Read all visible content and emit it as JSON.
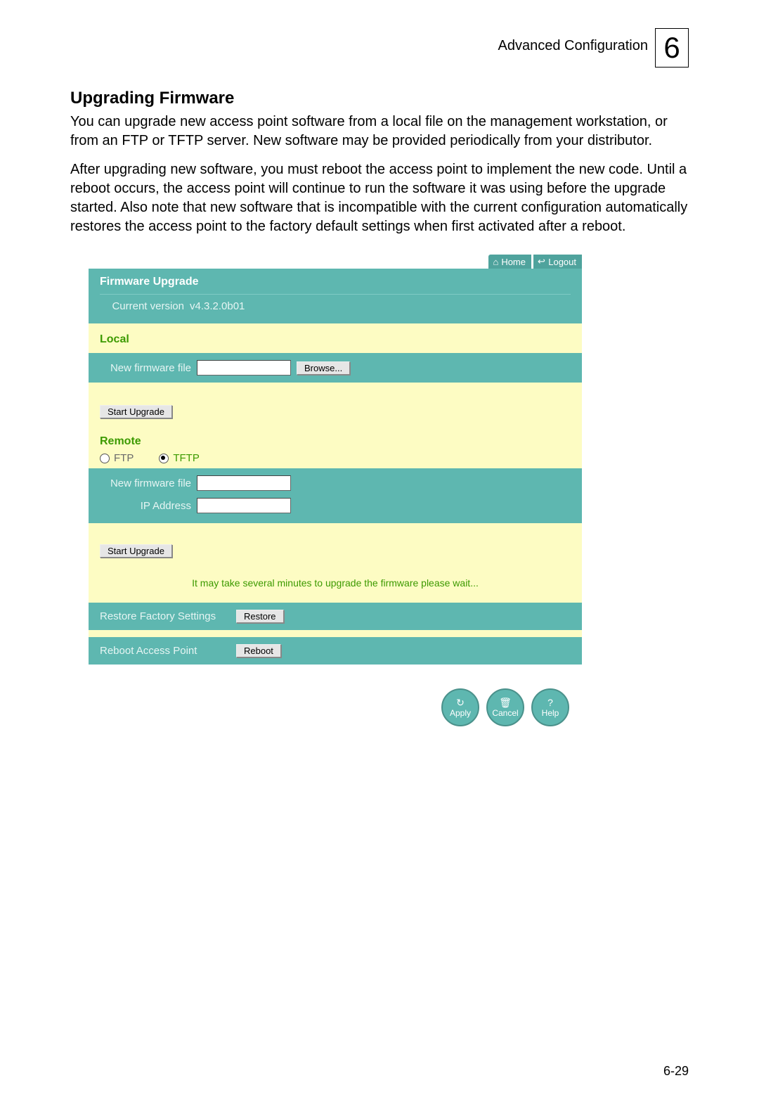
{
  "header": {
    "label": "Advanced Configuration",
    "chapter": "6"
  },
  "section_title": "Upgrading Firmware",
  "para1": "You can upgrade new access point software from a local file on the management workstation, or from an FTP or TFTP server. New software may be provided periodically from your distributor.",
  "para2": "After upgrading new software, you must reboot the access point to implement the new code. Until a reboot occurs, the access point will continue to run the software it was using before the upgrade started. Also note that new software that is incompatible with the current configuration automatically restores the access point to the factory default settings when first activated after a reboot.",
  "ui": {
    "topbar": {
      "home": "Home",
      "logout": "Logout"
    },
    "panel_title": "Firmware Upgrade",
    "current_version_label": "Current version",
    "current_version_value": "v4.3.2.0b01",
    "local_heading": "Local",
    "new_firmware_label": "New firmware file",
    "browse_btn": "Browse...",
    "start_upgrade_btn": "Start Upgrade",
    "remote_heading": "Remote",
    "protocol": {
      "ftp": "FTP",
      "tftp": "TFTP",
      "selected": "tftp"
    },
    "remote_firmware_label": "New firmware file",
    "ip_label": "IP Address",
    "remote_start_upgrade_btn": "Start Upgrade",
    "note": "It may take several minutes to upgrade the firmware please wait...",
    "restore_label": "Restore Factory Settings",
    "restore_btn": "Restore",
    "reboot_label": "Reboot Access Point",
    "reboot_btn": "Reboot",
    "footer": {
      "apply": "Apply",
      "cancel": "Cancel",
      "help": "Help"
    }
  },
  "page_number": "6-29"
}
